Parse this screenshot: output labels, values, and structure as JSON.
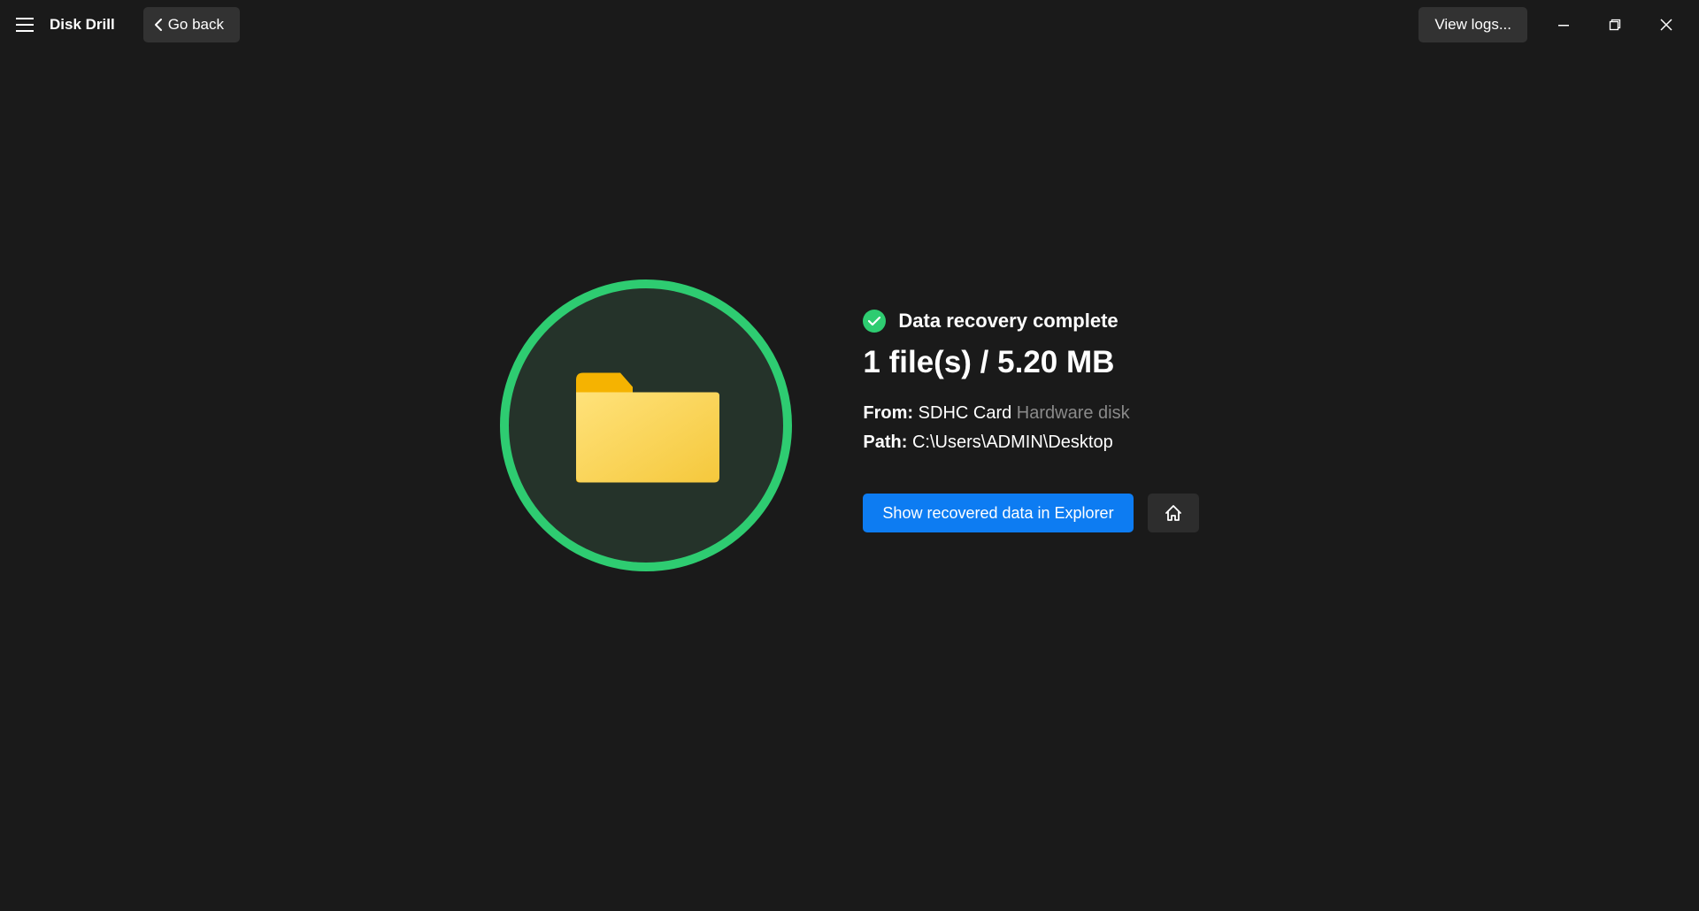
{
  "titlebar": {
    "app_title": "Disk Drill",
    "goback_label": "Go back",
    "viewlogs_label": "View logs..."
  },
  "main": {
    "status_text": "Data recovery complete",
    "summary": "1 file(s) / 5.20 MB",
    "from_label": "From:",
    "from_value": "SDHC Card",
    "from_suffix": "Hardware disk",
    "path_label": "Path:",
    "path_value": "C:\\Users\\ADMIN\\Desktop",
    "show_btn": "Show recovered data in Explorer"
  }
}
